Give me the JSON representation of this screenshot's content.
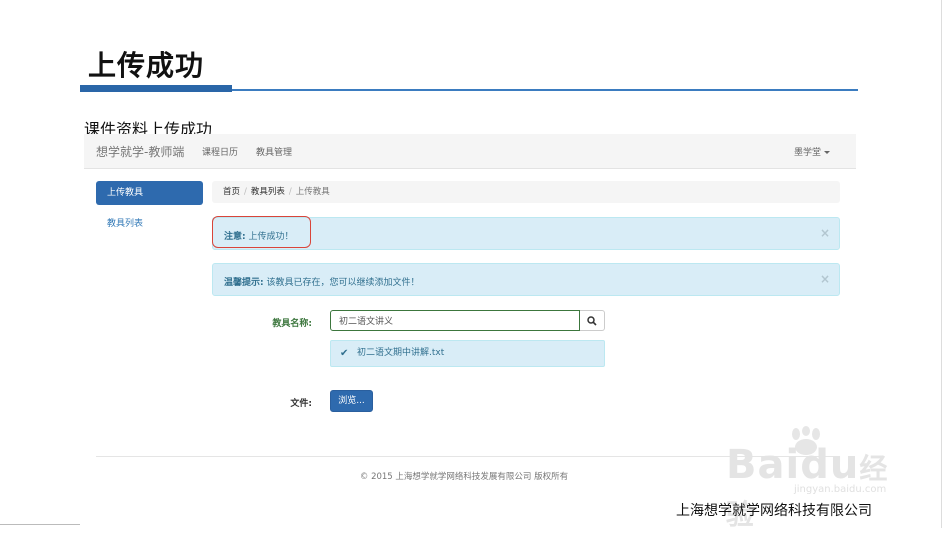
{
  "slide": {
    "title": "上传成功",
    "subtitle": "课件资料上传成功",
    "company": "上海想学就学网络科技有限公司"
  },
  "app": {
    "brand": "想学就学-教师端",
    "nav": [
      "课程日历",
      "教具管理"
    ],
    "user": "墨学堂",
    "sidebar": {
      "active": "上传教具",
      "items": [
        "教具列表"
      ]
    },
    "breadcrumb": [
      "首页",
      "教具列表",
      "上传教具"
    ],
    "alerts": [
      {
        "label": "注意:",
        "message": "上传成功！",
        "close": "×"
      },
      {
        "label": "温馨提示:",
        "message": "该教具已存在，您可以继续添加文件！",
        "close": "×"
      }
    ],
    "form": {
      "name_label": "教具名称:",
      "name_value": "初二语文讲义",
      "result_file": "初二语文期中讲解.txt",
      "file_label": "文件:",
      "browse_label": "浏览..."
    },
    "copyright": "© 2015 上海想学就学网络科技发展有限公司 版权所有"
  },
  "watermark": {
    "text": "Bai",
    "text2": "du",
    "text3": "经验",
    "sub": "jingyan.baidu.com"
  },
  "colors": {
    "primary": "#2e6aae",
    "alert_bg": "#d9edf7",
    "alert_text": "#31708f",
    "highlight": "#d9453a",
    "success_green": "#3c763d"
  }
}
